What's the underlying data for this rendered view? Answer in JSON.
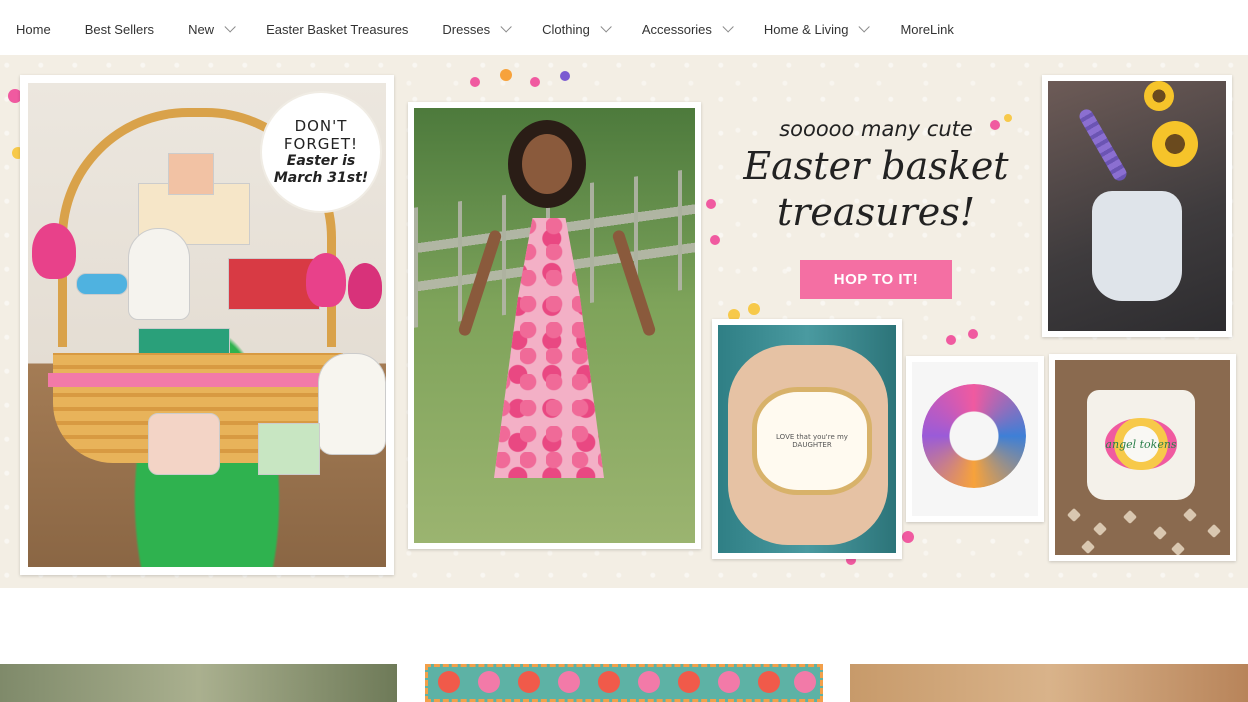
{
  "nav": {
    "items": [
      {
        "label": "Home",
        "has_dropdown": false
      },
      {
        "label": "Best Sellers",
        "has_dropdown": false
      },
      {
        "label": "New",
        "has_dropdown": true
      },
      {
        "label": "Easter Basket Treasures",
        "has_dropdown": false
      },
      {
        "label": "Dresses",
        "has_dropdown": true
      },
      {
        "label": "Clothing",
        "has_dropdown": true
      },
      {
        "label": "Accessories",
        "has_dropdown": true
      },
      {
        "label": "Home & Living",
        "has_dropdown": true
      },
      {
        "label": "MoreLink",
        "has_dropdown": false
      }
    ]
  },
  "hero": {
    "badge": {
      "line1": "DON'T",
      "line2": "FORGET!",
      "line3": "Easter is",
      "line4": "March 31st!"
    },
    "headline_small": "sooooo many cute",
    "headline_line1": "Easter basket",
    "headline_line2": "treasures!",
    "cta_label": "HOP TO IT!",
    "dish_text": "LOVE that you're my DAUGHTER",
    "bag_text": "angel tokens",
    "colors": {
      "cta": "#f46fa3",
      "background": "#f3eee4"
    }
  }
}
